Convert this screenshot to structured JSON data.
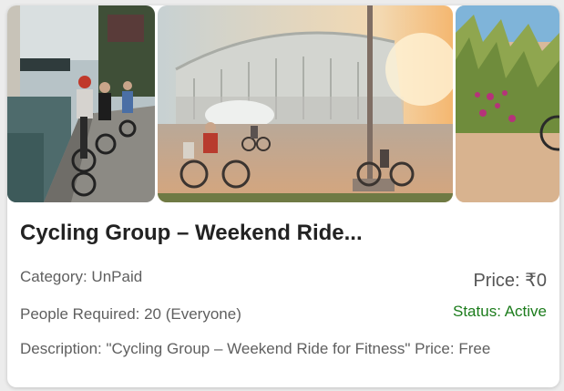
{
  "photos": [
    {
      "alt": "cyclists-canal-path"
    },
    {
      "alt": "cyclists-stadium-sunset"
    },
    {
      "alt": "bike-grassy-dunes"
    }
  ],
  "listing": {
    "title": "Cycling Group – Weekend Ride...",
    "category": "Category: UnPaid",
    "price": "Price: ₹0",
    "people": "People Required: 20 (Everyone)",
    "status": "Status: Active",
    "description": "Description: \"Cycling Group – Weekend Ride for Fitness\" Price: Free"
  },
  "colors": {
    "status_active": "#1c7c1c",
    "title": "#222222",
    "text_secondary": "#5f5f5f"
  }
}
